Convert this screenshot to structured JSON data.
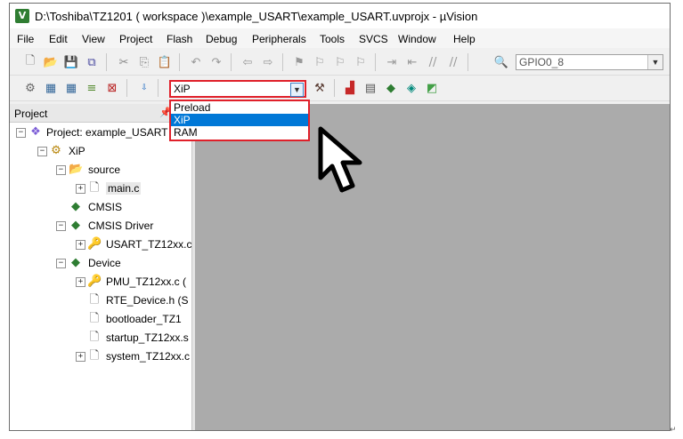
{
  "window": {
    "title": "D:\\Toshiba\\TZ1201 ( workspace )\\example_USART\\example_USART.uvprojx - µVision",
    "app_icon": "uvision-logo-icon",
    "app_icon_glyph": "V"
  },
  "menu": [
    "File",
    "Edit",
    "View",
    "Project",
    "Flash",
    "Debug",
    "Peripherals",
    "Tools",
    "SVCS",
    "Window",
    "Help"
  ],
  "toolbar1": {
    "find_combo_value": "GPIO0_8"
  },
  "toolbar2": {
    "target_value": "XiP",
    "target_options": [
      "Preload",
      "XiP",
      "RAM"
    ],
    "selected_option": "XiP"
  },
  "project_panel": {
    "title": "Project",
    "tree": {
      "root": "Project: example_USART",
      "target": "XiP",
      "group_source": "source",
      "file_main": "main.c",
      "cmsis": "CMSIS",
      "cmsis_driver": "CMSIS Driver",
      "file_usart": "USART_TZ12xx.c",
      "device": "Device",
      "file_pmu": "PMU_TZ12xx.c (",
      "file_rte": "RTE_Device.h (S",
      "file_bootloader": "bootloader_TZ1",
      "file_startup": "startup_TZ12xx.s",
      "file_system": "system_TZ12xx.c"
    }
  },
  "colors": {
    "highlight_border": "#e0202a",
    "selection": "#0078d7",
    "editor_bg": "#ababab"
  }
}
